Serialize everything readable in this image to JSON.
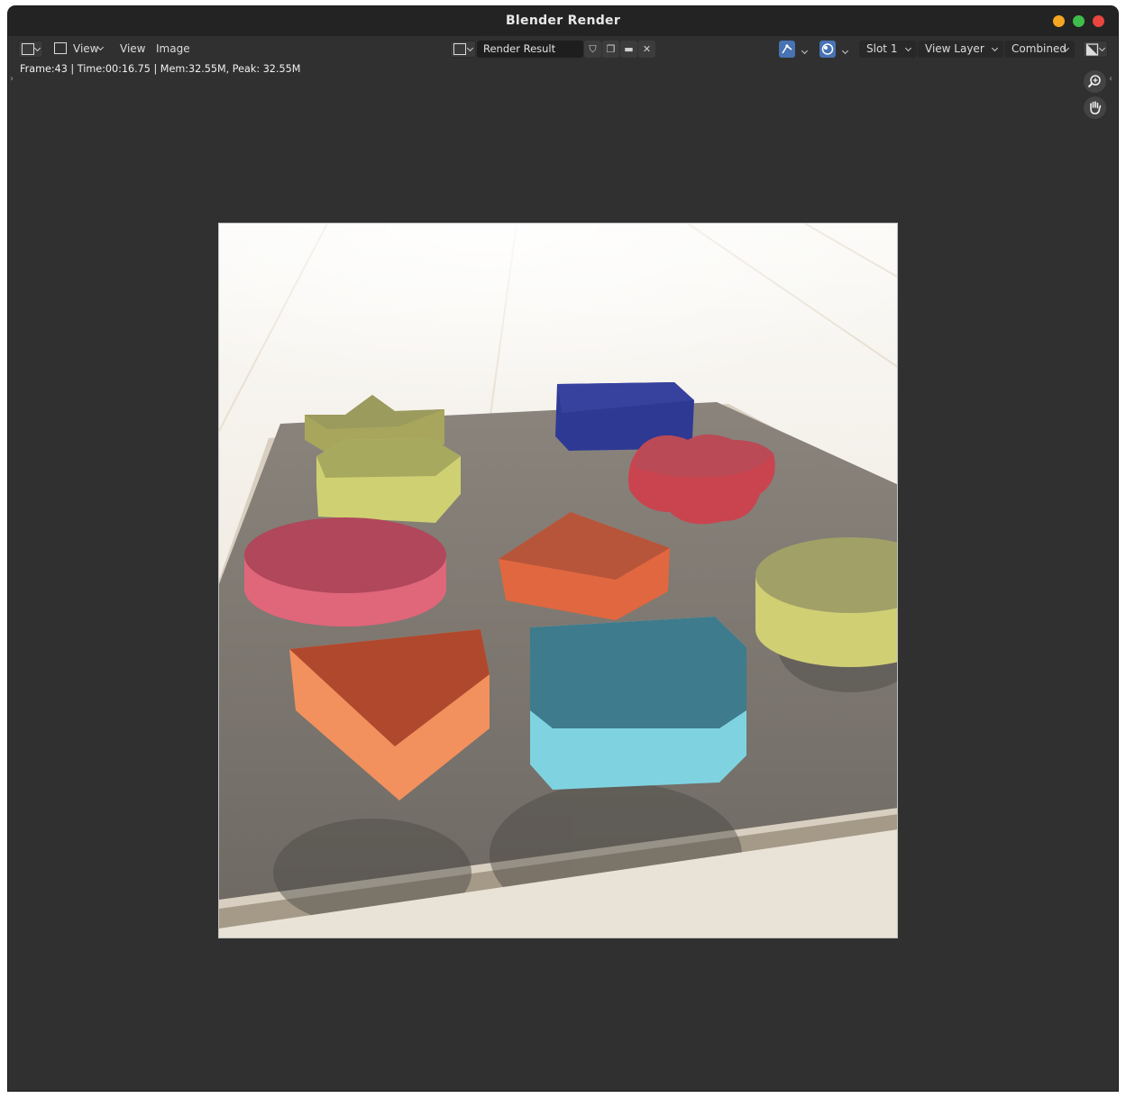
{
  "window": {
    "title": "Blender Render"
  },
  "header": {
    "menu_view_1": "View",
    "menu_view_2": "View",
    "menu_image": "Image",
    "image_name": "Render Result",
    "slot": "Slot 1",
    "view_layer": "View Layer",
    "pass": "Combined"
  },
  "status": {
    "text": "Frame:43 | Time:00:16.75 | Mem:32.55M, Peak: 32.55M"
  },
  "icons": {
    "editor_type": "image-editor-icon",
    "mode": "image-view-icon",
    "image_browse": "image-browse-icon",
    "fake_user": "shield-icon",
    "duplicate": "duplicate-icon",
    "open": "folder-icon",
    "unlink": "close-icon",
    "gizmo": "gizmo-icon",
    "overlay": "overlay-icon",
    "display_channels": "display-channels-icon",
    "zoom": "zoom-icon",
    "pan": "hand-icon"
  },
  "colors": {
    "accent": "#4772b3",
    "window_bg": "#303030",
    "titlebar_bg": "#232323"
  }
}
